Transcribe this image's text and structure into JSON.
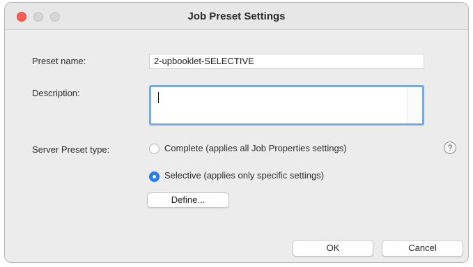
{
  "window": {
    "title": "Job Preset Settings",
    "traffic_colors": {
      "close": "#ff5f57",
      "inactive": "#d6d6d6"
    }
  },
  "form": {
    "preset_name": {
      "label": "Preset name:",
      "value": "2-upbooklet-SELECTIVE"
    },
    "description": {
      "label": "Description:",
      "value": ""
    },
    "server_preset_type": {
      "label": "Server Preset type:",
      "options": [
        {
          "label": "Complete (applies all Job Properties settings)",
          "selected": false
        },
        {
          "label": "Selective (applies only specific settings)",
          "selected": true
        }
      ],
      "help_icon": "?"
    },
    "define_button": "Define..."
  },
  "footer": {
    "ok_button": "OK",
    "cancel_button": "Cancel"
  },
  "colors": {
    "accent": "#2a7ef5",
    "focus_ring": "#79a7e4"
  }
}
